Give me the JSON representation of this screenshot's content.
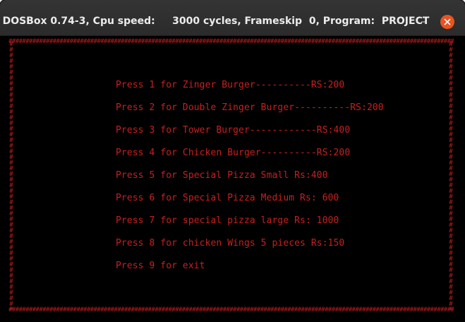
{
  "window": {
    "title": "DOSBox 0.74-3, Cpu speed:     3000 cycles, Frameskip  0, Program:  PROJECT",
    "minimize_label": "–",
    "close_icon": "close-icon",
    "colors": {
      "titlebar": "#2b2b2b",
      "close_button": "#e95420",
      "screen_bg": "#000000",
      "text_red": "#c8201e"
    }
  },
  "screen": {
    "border_char": "#",
    "menu": [
      "Press 1 for Zinger Burger----------RS:200",
      "Press 2 for Double Zinger Burger----------RS:200",
      "Press 3 for Tower Burger------------RS:400",
      "Press 4 for Chicken Burger----------RS:200",
      "Press 5 for Special Pizza Small Rs:400",
      "Press 6 for Special Pizza Medium Rs: 600",
      "Press 7 for special pizza large Rs: 1000",
      "Press 8 for chicken Wings 5 pieces Rs:150",
      "Press 9 for exit"
    ]
  }
}
